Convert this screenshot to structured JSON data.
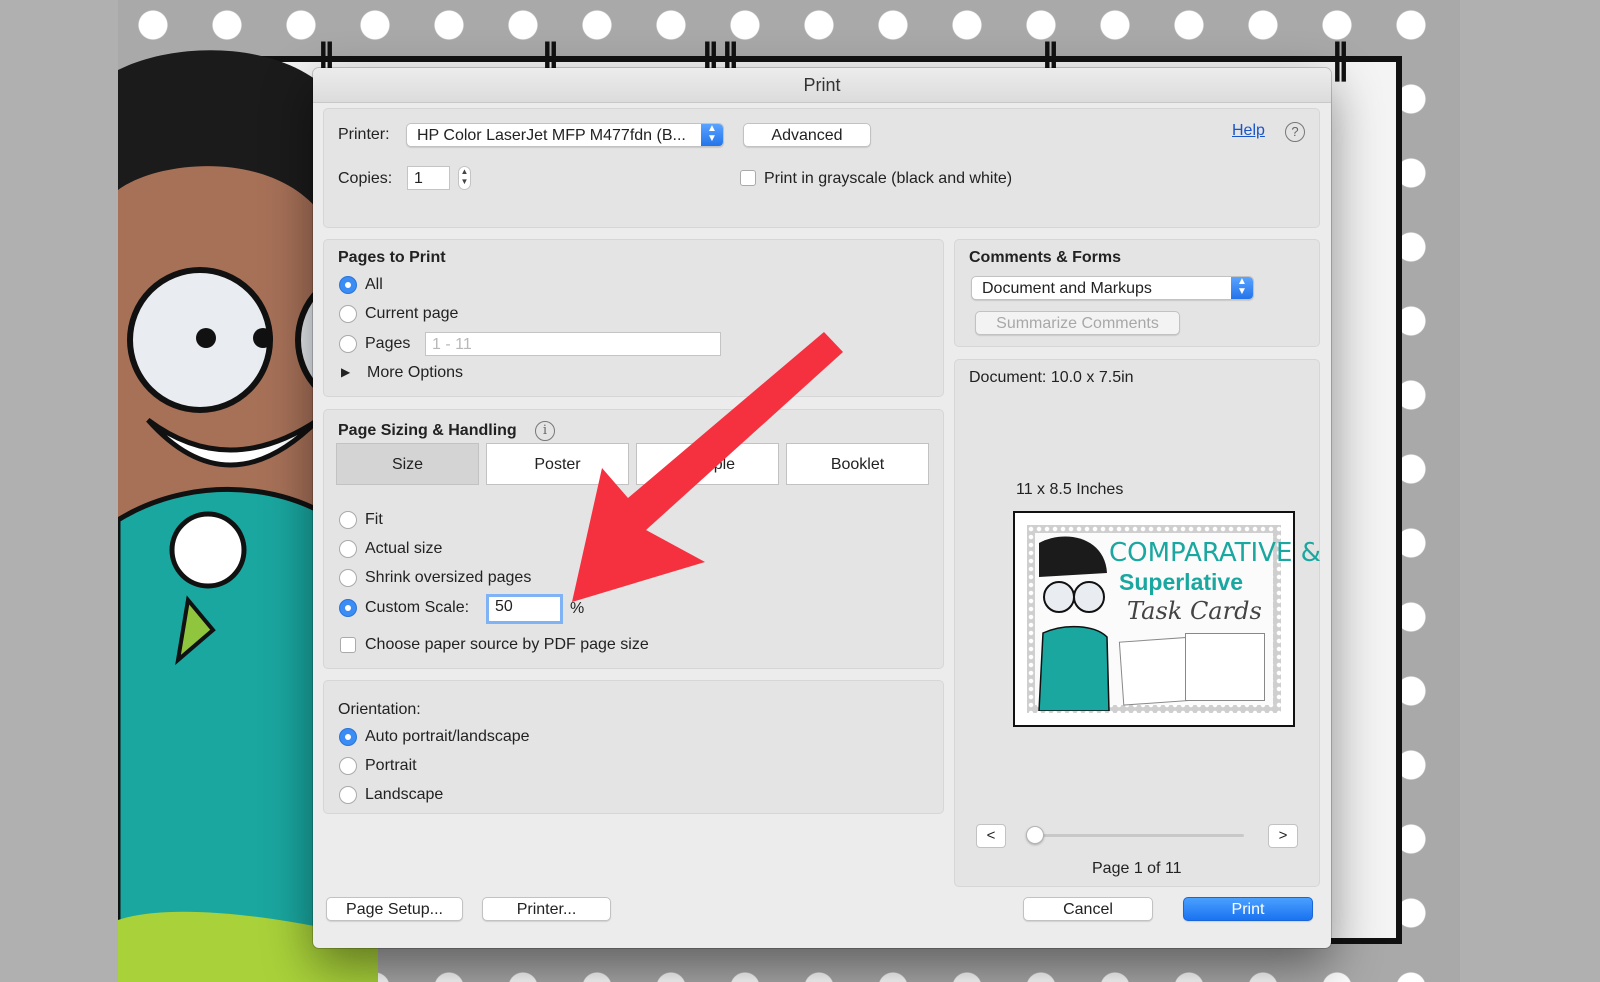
{
  "dialog": {
    "title": "Print"
  },
  "printer": {
    "label": "Printer:",
    "value": "HP Color LaserJet MFP M477fdn (B...",
    "advanced_label": "Advanced",
    "help_label": "Help",
    "help_icon": "?"
  },
  "copies": {
    "label": "Copies:",
    "value": "1",
    "grayscale_label": "Print in grayscale (black and white)",
    "grayscale_checked": false
  },
  "pages_to_print": {
    "title": "Pages to Print",
    "options": [
      {
        "label": "All",
        "selected": true
      },
      {
        "label": "Current page",
        "selected": false
      },
      {
        "label": "Pages",
        "selected": false
      }
    ],
    "range_placeholder": "1 - 11",
    "more_options_label": "More Options"
  },
  "page_sizing": {
    "title": "Page Sizing & Handling",
    "info_icon": "i",
    "tabs": [
      "Size",
      "Poster",
      "Multiple",
      "Booklet"
    ],
    "selected_tab": "Size",
    "options": [
      {
        "label": "Fit",
        "selected": false
      },
      {
        "label": "Actual size",
        "selected": false
      },
      {
        "label": "Shrink oversized pages",
        "selected": false
      },
      {
        "label": "Custom Scale:",
        "selected": true
      }
    ],
    "scale_value": "50",
    "scale_unit": "%",
    "paper_source_label": "Choose paper source by PDF page size",
    "paper_source_checked": false
  },
  "orientation": {
    "title": "Orientation:",
    "options": [
      {
        "label": "Auto portrait/landscape",
        "selected": true
      },
      {
        "label": "Portrait",
        "selected": false
      },
      {
        "label": "Landscape",
        "selected": false
      }
    ]
  },
  "comments_forms": {
    "title": "Comments & Forms",
    "value": "Document and Markups",
    "summarize_label": "Summarize Comments"
  },
  "preview": {
    "document_size": "Document: 10.0 x 7.5in",
    "paper_size": "11 x 8.5 Inches",
    "thumbnail_title": "COMPARATIVE &",
    "thumbnail_subtitle": "Superlative",
    "thumbnail_script": "Task Cards",
    "prev_label": "<",
    "next_label": ">",
    "page_indicator": "Page 1 of 11",
    "current_page": 1,
    "total_pages": 11
  },
  "footer": {
    "page_setup_label": "Page Setup...",
    "printer_label": "Printer...",
    "cancel_label": "Cancel",
    "print_label": "Print"
  },
  "annotation": {
    "color": "#f5303f"
  },
  "colors": {
    "accent": "#1a73f0",
    "link": "#1a55c8"
  }
}
